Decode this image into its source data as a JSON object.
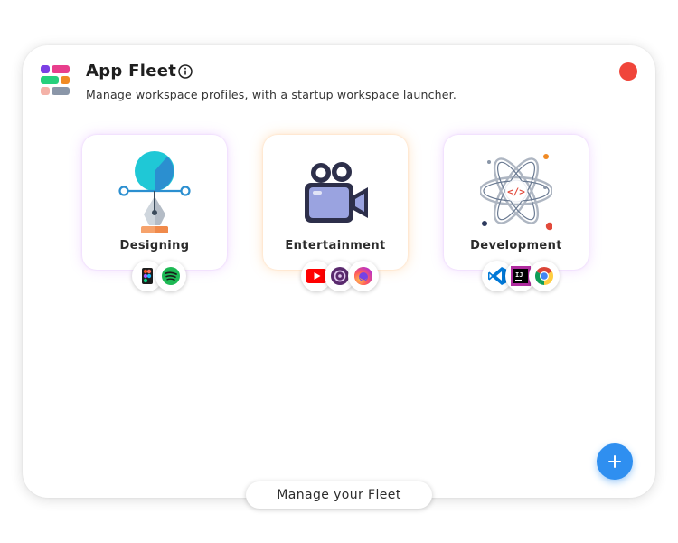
{
  "app": {
    "title": "App Fleet",
    "subtitle": "Manage workspace profiles, with a startup workspace launcher."
  },
  "workspaces": [
    {
      "label": "Designing",
      "icon": "pen-tool-icon",
      "apps": [
        "figma-icon",
        "spotify-icon"
      ]
    },
    {
      "label": "Entertainment",
      "icon": "video-camera-icon",
      "apps": [
        "youtube-icon",
        "media-player-icon",
        "firefox-icon"
      ]
    },
    {
      "label": "Development",
      "icon": "atom-code-icon",
      "apps": [
        "vscode-icon",
        "intellij-icon",
        "chrome-icon"
      ]
    }
  ],
  "footer": {
    "manage_label": "Manage your Fleet"
  },
  "colors": {
    "accent": "#2f8ff0",
    "close": "#f0453a"
  }
}
